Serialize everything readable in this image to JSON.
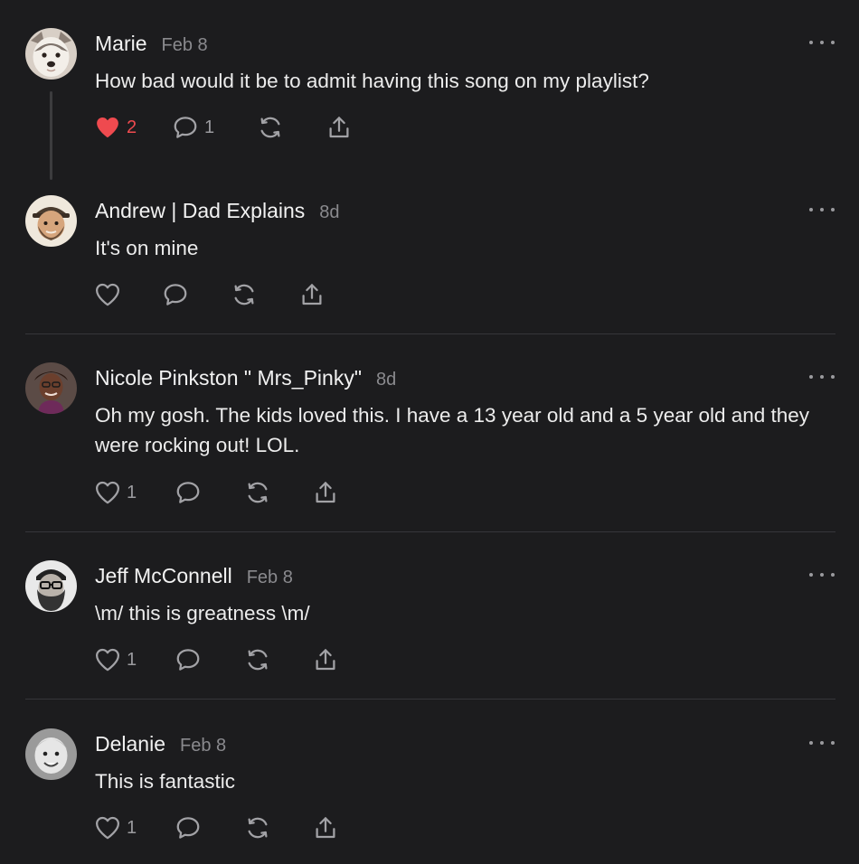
{
  "comments": [
    {
      "author": "Marie",
      "date": "Feb 8",
      "text": "How bad would it be to admit having this song on my playlist?",
      "liked": true,
      "like_count": "2",
      "reply_count": "1",
      "avatar_icon": "husky-dog-avatar"
    },
    {
      "author": "Andrew | Dad Explains",
      "date": "8d",
      "text": "It's on mine",
      "liked": false,
      "like_count": "",
      "reply_count": "",
      "avatar_icon": "illustrated-man-hat-avatar"
    },
    {
      "author": "Nicole Pinkston \" Mrs_Pinky\"",
      "date": "8d",
      "text": "Oh my gosh. The kids loved this. I have a 13 year old and a 5 year old and they were rocking out! LOL.",
      "liked": false,
      "like_count": "1",
      "reply_count": "",
      "avatar_icon": "woman-glasses-avatar"
    },
    {
      "author": "Jeff McConnell",
      "date": "Feb 8",
      "text": "\\m/ this is greatness \\m/",
      "liked": false,
      "like_count": "1",
      "reply_count": "",
      "avatar_icon": "bearded-man-glasses-avatar"
    },
    {
      "author": "Delanie",
      "date": "Feb 8",
      "text": "This is fantastic",
      "liked": false,
      "like_count": "1",
      "reply_count": "",
      "avatar_icon": "child-bw-avatar"
    }
  ],
  "colors": {
    "background": "#1c1c1e",
    "liked_heart": "#ef4a4f",
    "muted_text": "#8a8a8e",
    "divider": "#36363a"
  }
}
